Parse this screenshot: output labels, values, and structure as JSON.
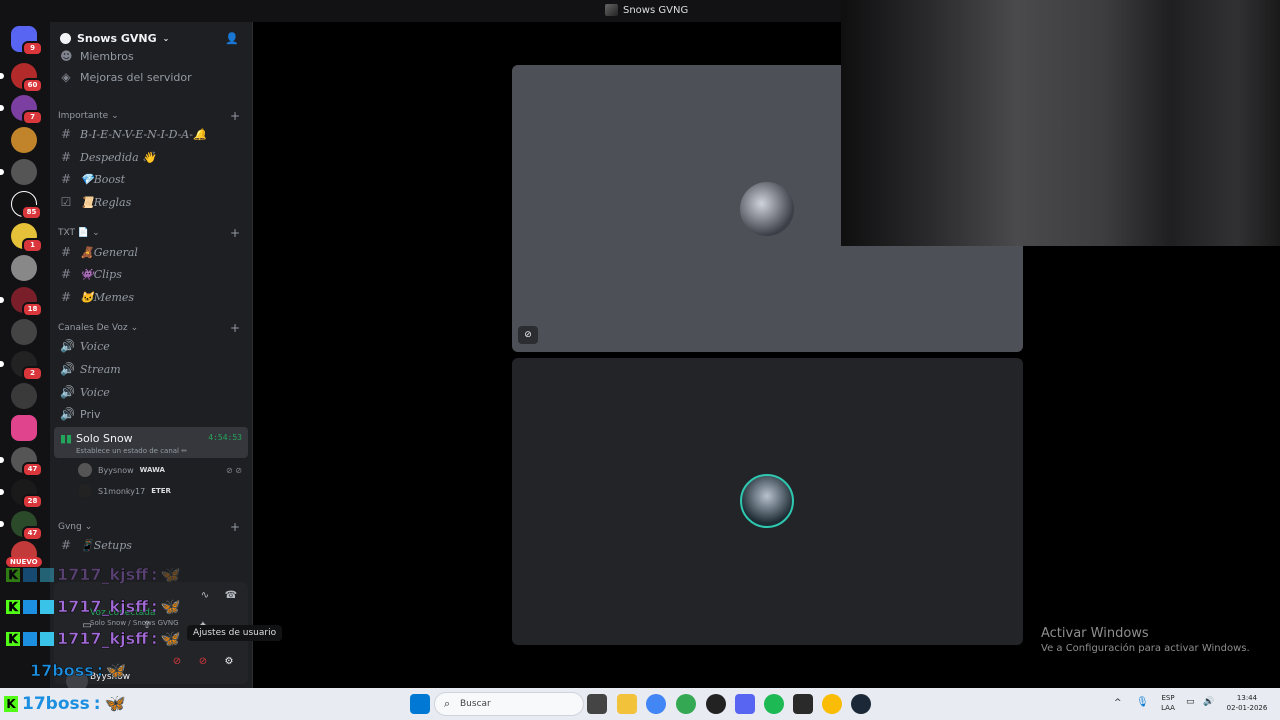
{
  "window": {
    "title": "Snows GVNG"
  },
  "server_rail": {
    "badges": [
      "9",
      "60",
      "7",
      "85",
      "1",
      "18",
      "2",
      "47",
      "28",
      "47"
    ],
    "nuevo_label": "NUEVO"
  },
  "server": {
    "name": "Snows GVNG",
    "top_items": [
      "Miembros",
      "Mejoras del servidor"
    ]
  },
  "categories": [
    {
      "name": "Importante",
      "channels": [
        "B-I-E-N-V-E-N-I-D-A-🔔",
        "Despedida 👋",
        "💎Boost",
        "📜Reglas"
      ]
    },
    {
      "name": "TXT 📄",
      "channels": [
        "🧸General",
        "👾Clips",
        "🐱Memes"
      ]
    },
    {
      "name": "Canales De Voz",
      "channels": [
        "Voice",
        "Stream",
        "Voice",
        "Priv"
      ]
    },
    {
      "name": "Gvng",
      "channels": [
        "📱Setups"
      ]
    }
  ],
  "active_voice": {
    "name": "Solo Snow",
    "timer": "4:54:53",
    "status": "Establece un estado de canal ✏",
    "users": [
      {
        "name": "Byysnow",
        "tag": "WAWA"
      },
      {
        "name": "S1monky17",
        "tag": "ETER"
      }
    ]
  },
  "voice_panel": {
    "status": "Voz conectada",
    "sub": "Solo Snow / Snows GVNG",
    "username": "Byysnow",
    "tooltip": "Ajustes de usuario"
  },
  "overlay_chat": [
    {
      "user": "1717_kjsff",
      "sep": ":"
    },
    {
      "user": "1717_kjsff",
      "sep": ":"
    },
    {
      "user": "1717_kjsff",
      "sep": ":"
    },
    {
      "user": "17boss",
      "sep": ":"
    }
  ],
  "kick_bottom": {
    "user": "17boss",
    "sep": ":"
  },
  "watermark": {
    "line1": "Activar Windows",
    "line2": "Ve a Configuración para activar Windows."
  },
  "taskbar": {
    "search_placeholder": "Buscar",
    "lang1": "ESP",
    "lang2": "LAA",
    "time": "13:44",
    "date": "02-01-2026"
  }
}
